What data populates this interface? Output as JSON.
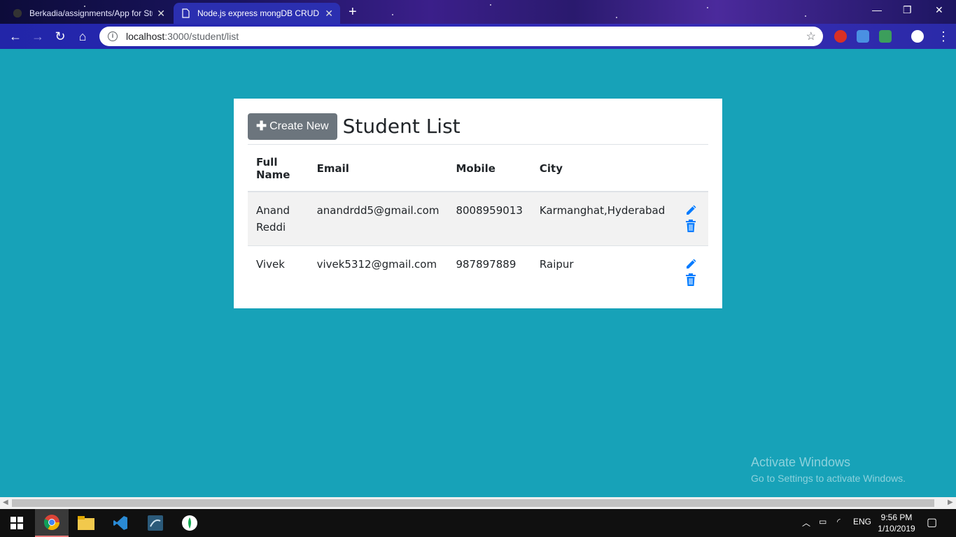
{
  "browser": {
    "tabs": [
      {
        "title": "Berkadia/assignments/App for Stu",
        "active": false
      },
      {
        "title": "Node.js express mongDB CRUD",
        "active": true
      }
    ],
    "url_host": "localhost",
    "url_path": ":3000/student/list"
  },
  "page": {
    "create_button_label": "Create New",
    "title": "Student List",
    "columns": [
      "Full Name",
      "Email",
      "Mobile",
      "City"
    ],
    "rows": [
      {
        "full_name": "Anand Reddi",
        "email": "anandrdd5@gmail.com",
        "mobile": "8008959013",
        "city": "Karmanghat,Hyderabad"
      },
      {
        "full_name": "Vivek",
        "email": "vivek5312@gmail.com",
        "mobile": "987897889",
        "city": "Raipur"
      }
    ],
    "icons": {
      "edit": "pencil-icon",
      "delete": "trash-icon"
    },
    "colors": {
      "background": "#17a2b8",
      "button": "#6c757d",
      "action_icons": "#007bff"
    }
  },
  "watermark": {
    "line1": "Activate Windows",
    "line2": "Go to Settings to activate Windows."
  },
  "taskbar": {
    "language": "ENG",
    "time": "9:56 PM",
    "date": "1/10/2019"
  }
}
